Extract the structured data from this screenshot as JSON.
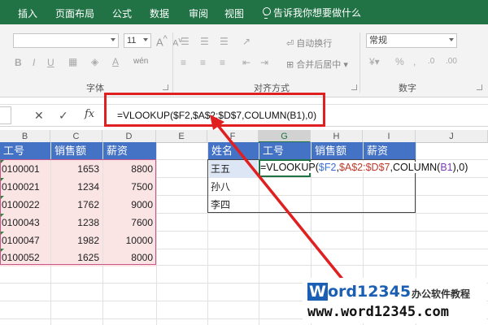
{
  "ribbon": {
    "tabs": [
      "插入",
      "页面布局",
      "公式",
      "数据",
      "审阅",
      "视图"
    ],
    "tell_me": "告诉我你想要做什么",
    "font_size": "11",
    "wrap_text_label": "自动换行",
    "merge_center_label": "合并后居中",
    "number_format": "常规",
    "font_group_label": "字体",
    "alignment_group_label": "对齐方式",
    "number_group_label": "数字",
    "increase_font": "A",
    "decrease_font": "A",
    "phonetic": "wén"
  },
  "formula_bar": {
    "cancel_icon": "close-icon",
    "enter_icon": "check-icon",
    "fx_label": "fx",
    "formula": "=VLOOKUP($F2,$A$2:$D$7,COLUMN(B1),0)"
  },
  "columns": [
    "B",
    "C",
    "D",
    "E",
    "F",
    "G",
    "H",
    "I",
    "J"
  ],
  "left_table": {
    "headers": [
      "工号",
      "销售额",
      "薪资"
    ],
    "rows": [
      [
        "0100001",
        "1653",
        "8800"
      ],
      [
        "0100021",
        "1234",
        "7500"
      ],
      [
        "0100022",
        "1762",
        "9000"
      ],
      [
        "0100043",
        "1238",
        "7600"
      ],
      [
        "0100047",
        "1982",
        "10000"
      ],
      [
        "0100052",
        "1625",
        "8000"
      ]
    ]
  },
  "right_table": {
    "headers": [
      "姓名",
      "工号",
      "销售额",
      "薪资"
    ],
    "names": [
      "王五",
      "孙八",
      "李四"
    ]
  },
  "in_cell_formula": {
    "p1": "=VLOOKUP(",
    "p2": "$F2",
    "p3": ",",
    "p4": "$A$2:$D$7",
    "p5": ",COLUMN(",
    "p6": "B1",
    "p7": "),0)"
  },
  "watermark": {
    "w": "W",
    "brand": "ord12345",
    "tag": "办公软件教程",
    "url": "www.word12345.com"
  },
  "colors": {
    "ribbon_green": "#217346",
    "header_blue": "#4472c4",
    "highlight_red": "#e02020",
    "pink_fill": "#fae4e4"
  }
}
